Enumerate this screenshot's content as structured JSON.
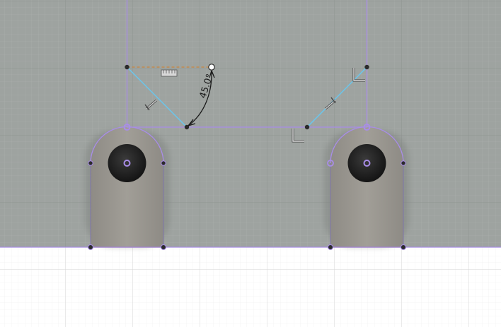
{
  "viewport": {
    "background_color": "#9ea3a0",
    "grid_color": "#b7bbb8",
    "ground_color": "#ffffff",
    "ground_grid_color": "#e3e3e3"
  },
  "sketch": {
    "profile_color": "#a98de8",
    "construction_color": "#6ec3e6",
    "dashed_color": "#c98640",
    "point_color": "#2b2b2b",
    "dimension": {
      "angle_label": "45.0°"
    }
  },
  "bodies": {
    "left_tab": {
      "fill": "#9a9790"
    },
    "right_tab": {
      "fill": "#9a9790"
    },
    "hole_fill": "#1f1f1f",
    "hole_center_color": "#a98de8"
  },
  "constraint_icons": [
    "horizontal-constraint-icon",
    "tangent-constraint-icon",
    "perpendicular-constraint-icon",
    "perpendicular-constraint-icon",
    "tangent-constraint-icon"
  ]
}
